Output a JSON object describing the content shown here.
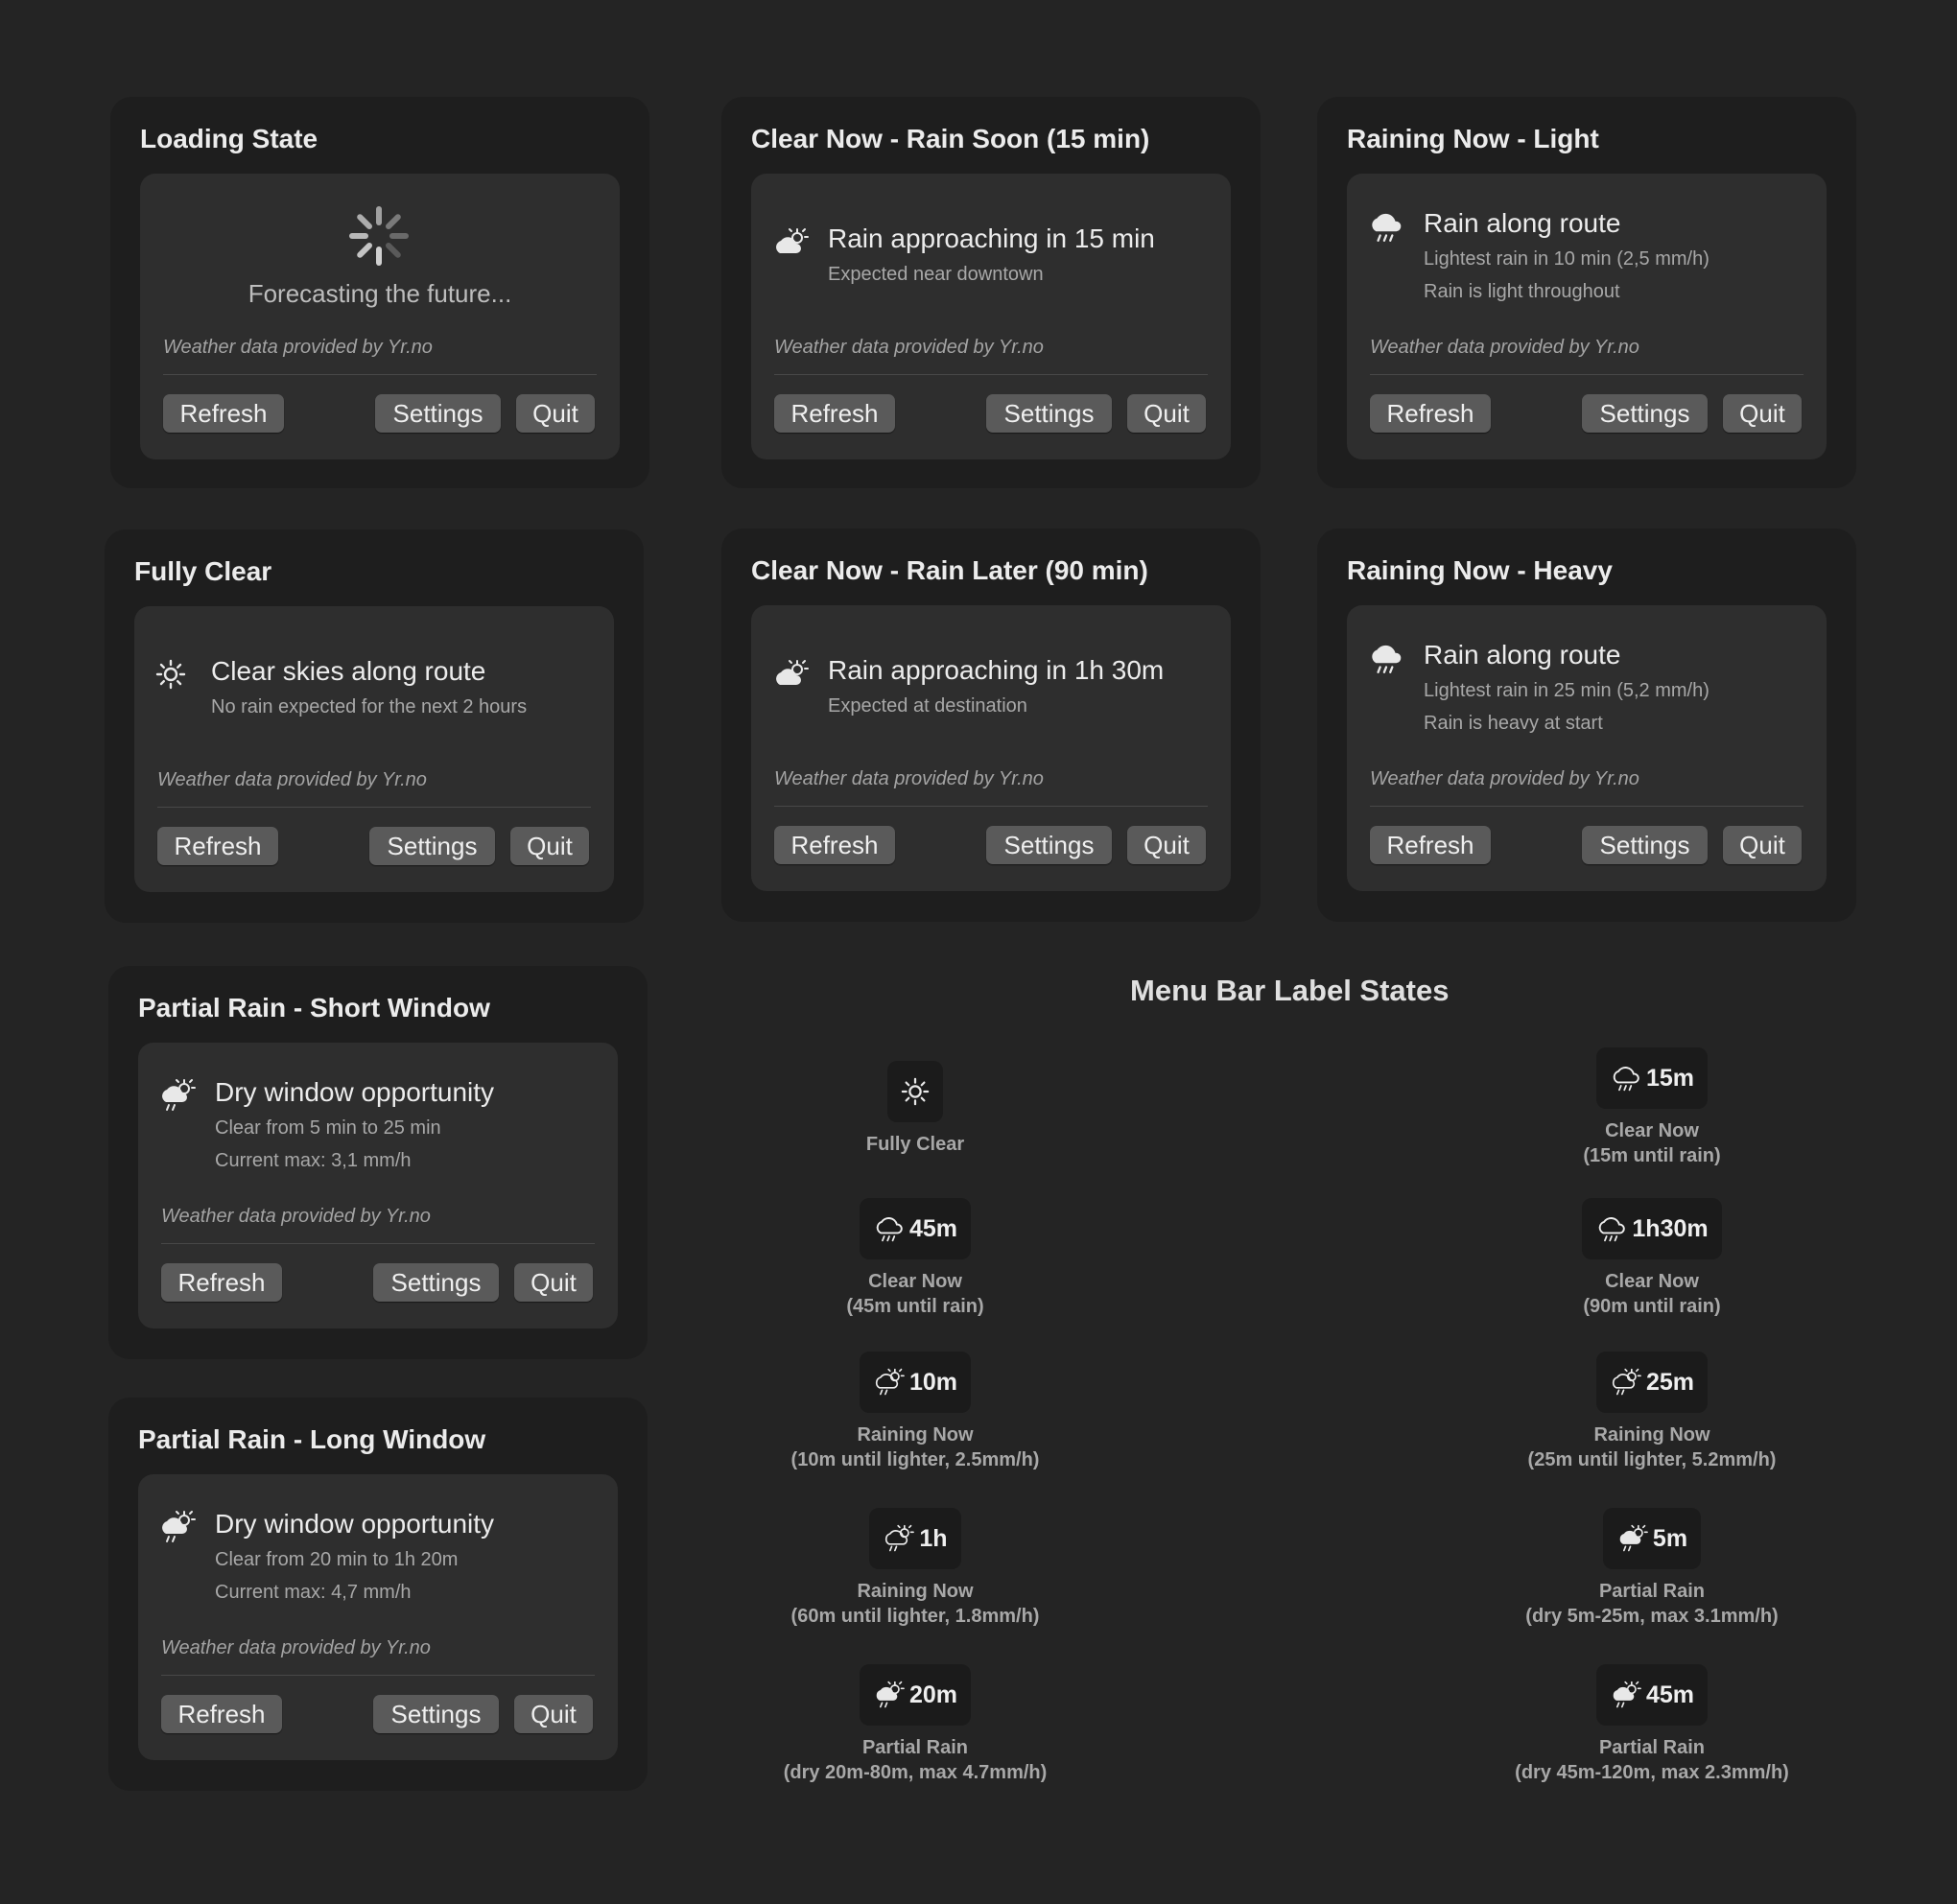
{
  "common": {
    "attribution": "Weather data provided by Yr.no",
    "refresh": "Refresh",
    "settings": "Settings",
    "quit": "Quit"
  },
  "panels": {
    "loading": {
      "title": "Loading State",
      "text": "Forecasting the future...",
      "icon": "spinner-icon"
    },
    "rain_soon": {
      "title": "Clear Now - Rain Soon (15 min)",
      "headline": "Rain approaching in 15 min",
      "line1": "Expected near downtown",
      "icon": "partly-cloudy-sun-icon"
    },
    "rain_light": {
      "title": "Raining Now - Light",
      "headline": "Rain along route",
      "line1": "Lightest rain in 10 min (2,5 mm/h)",
      "line2": "Rain is light throughout",
      "icon": "rain-cloud-icon"
    },
    "fully_clear": {
      "title": "Fully Clear",
      "headline": "Clear skies along route",
      "line1": "No rain expected for the next 2 hours",
      "icon": "sun-icon"
    },
    "rain_later": {
      "title": "Clear Now - Rain Later (90 min)",
      "headline": "Rain approaching in 1h 30m",
      "line1": "Expected at destination",
      "icon": "partly-cloudy-sun-icon"
    },
    "rain_heavy": {
      "title": "Raining Now - Heavy",
      "headline": "Rain along route",
      "line1": "Lightest rain in 25 min (5,2 mm/h)",
      "line2": "Rain is heavy at start",
      "icon": "rain-cloud-icon"
    },
    "partial_short": {
      "title": "Partial Rain - Short Window",
      "headline": "Dry window opportunity",
      "line1": "Clear from 5 min to 25 min",
      "line2": "Current max: 3,1 mm/h",
      "icon": "sun-rain-cloud-icon"
    },
    "partial_long": {
      "title": "Partial Rain - Long Window",
      "headline": "Dry window opportunity",
      "line1": "Clear from 20 min to 1h 20m",
      "line2": "Current max: 4,7 mm/h",
      "icon": "sun-rain-cloud-icon"
    }
  },
  "menubar": {
    "title": "Menu Bar Label States",
    "states": [
      {
        "label": "",
        "icon": "sun-icon",
        "cap1": "Fully Clear",
        "cap2": ""
      },
      {
        "label": "15m",
        "icon": "rain-cloud-outline-icon",
        "cap1": "Clear Now",
        "cap2": "(15m until rain)"
      },
      {
        "label": "45m",
        "icon": "rain-cloud-outline-icon",
        "cap1": "Clear Now",
        "cap2": "(45m until rain)"
      },
      {
        "label": "1h30m",
        "icon": "rain-cloud-outline-icon",
        "cap1": "Clear Now",
        "cap2": "(90m until rain)"
      },
      {
        "label": "10m",
        "icon": "sun-rain-cloud-outline-icon",
        "cap1": "Raining Now",
        "cap2": "(10m until lighter, 2.5mm/h)"
      },
      {
        "label": "25m",
        "icon": "sun-rain-cloud-outline-icon",
        "cap1": "Raining Now",
        "cap2": "(25m until lighter, 5.2mm/h)"
      },
      {
        "label": "1h",
        "icon": "sun-rain-cloud-outline-icon",
        "cap1": "Raining Now",
        "cap2": "(60m until lighter, 1.8mm/h)"
      },
      {
        "label": "5m",
        "icon": "sun-rain-cloud-filled-icon",
        "cap1": "Partial Rain",
        "cap2": "(dry 5m-25m, max 3.1mm/h)"
      },
      {
        "label": "20m",
        "icon": "sun-rain-cloud-filled-icon",
        "cap1": "Partial Rain",
        "cap2": "(dry 20m-80m, max 4.7mm/h)"
      },
      {
        "label": "45m",
        "icon": "sun-rain-cloud-filled-icon",
        "cap1": "Partial Rain",
        "cap2": "(dry 45m-120m, max 2.3mm/h)"
      }
    ]
  }
}
